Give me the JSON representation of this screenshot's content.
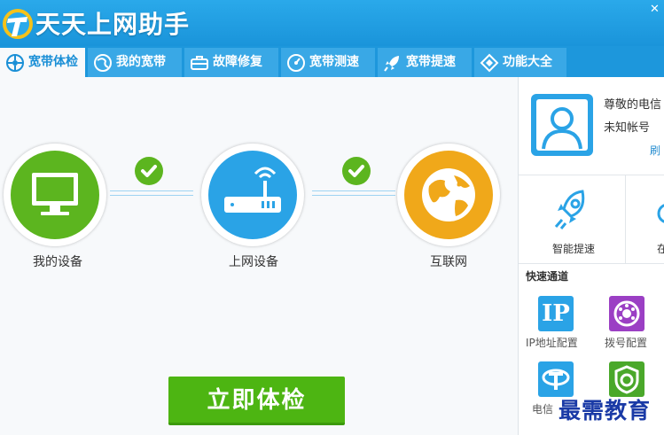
{
  "app": {
    "title": "天天上网助手"
  },
  "tabs": [
    {
      "label": "宽带体检",
      "icon": "network-check-icon",
      "active": true
    },
    {
      "label": "我的宽带",
      "icon": "globe-icon",
      "active": false
    },
    {
      "label": "故障修复",
      "icon": "toolbox-icon",
      "active": false
    },
    {
      "label": "宽带测速",
      "icon": "speedometer-icon",
      "active": false
    },
    {
      "label": "宽带提速",
      "icon": "rocket-icon",
      "active": false
    },
    {
      "label": "功能大全",
      "icon": "puzzle-icon",
      "active": false
    }
  ],
  "diagnosis": {
    "nodes": [
      {
        "label": "我的设备",
        "icon": "monitor-icon",
        "color": "#5cb51f"
      },
      {
        "label": "上网设备",
        "icon": "router-icon",
        "color": "#2aa3e6"
      },
      {
        "label": "互联网",
        "icon": "globe-icon",
        "color": "#f0a81a"
      }
    ],
    "start_button": "立即体检"
  },
  "account": {
    "greeting": "尊敬的电信",
    "account_label": "未知帐号",
    "refresh": "刷"
  },
  "features": [
    {
      "label": "智能提速",
      "icon": "rocket-icon"
    },
    {
      "label": "在",
      "icon": "cloud-icon"
    }
  ],
  "quick_channel": {
    "title": "快速通道",
    "items": [
      {
        "label": "IP地址配置",
        "icon": "ip-config-icon",
        "icon_text": "IP",
        "color": "#2aa3e6"
      },
      {
        "label": "拨号配置",
        "icon": "dial-icon",
        "color": "#9b3fc4"
      },
      {
        "label": "电信",
        "icon": "telecom-icon",
        "color": "#2aa3e6"
      },
      {
        "label": "",
        "icon": "shield-icon",
        "color": "#4aa82a"
      }
    ]
  },
  "watermark": "最需教育"
}
